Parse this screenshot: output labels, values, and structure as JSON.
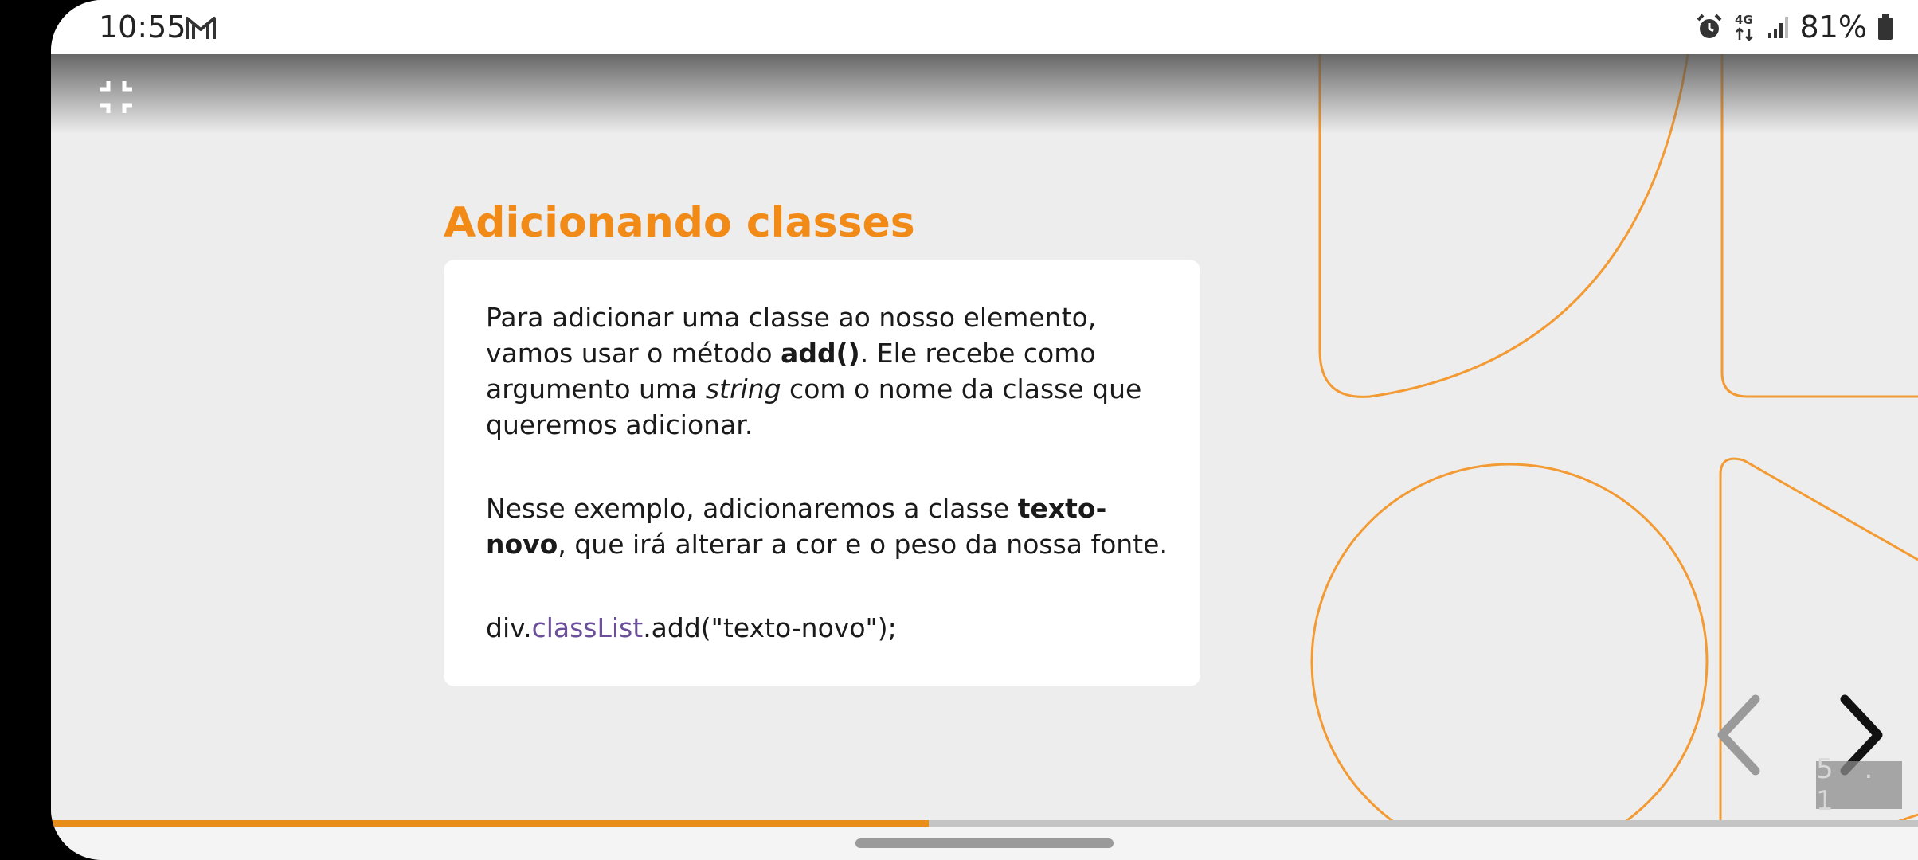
{
  "status_bar": {
    "time": "10:55",
    "network": "4G",
    "battery": "81%"
  },
  "icons": {
    "notification": "gmail-icon",
    "alarm": "alarm-icon",
    "network": "network-4g-icon",
    "signal": "signal-icon",
    "battery": "battery-icon",
    "exit_fullscreen": "exit-fullscreen-icon",
    "prev": "chevron-left-icon",
    "next": "chevron-right-icon"
  },
  "slide": {
    "title": "Adicionando classes",
    "paragraph1": {
      "before_bold": "Para adicionar uma classe ao nosso elemento, vamos usar o método ",
      "bold": "add()",
      "after_bold": ". Ele recebe como argumento uma ",
      "italic": "string",
      "after_italic": " com o nome da classe que queremos adicionar."
    },
    "paragraph2": {
      "before_bold": "Nesse exemplo, adicionaremos a classe ",
      "bold": "texto-novo",
      "after_bold": ", que irá alterar a cor e o peso da nossa fonte."
    },
    "code": {
      "object": "div.",
      "property": "classList",
      "call": ".add(\"texto-novo\");"
    },
    "slide_number": "5 . 1",
    "progress_fraction": 0.47
  },
  "colors": {
    "accent": "#f28a17",
    "decor_stroke": "#f39a33",
    "code_property": "#6c4f9b",
    "progress": "#e88c1a",
    "background": "#ededed"
  }
}
